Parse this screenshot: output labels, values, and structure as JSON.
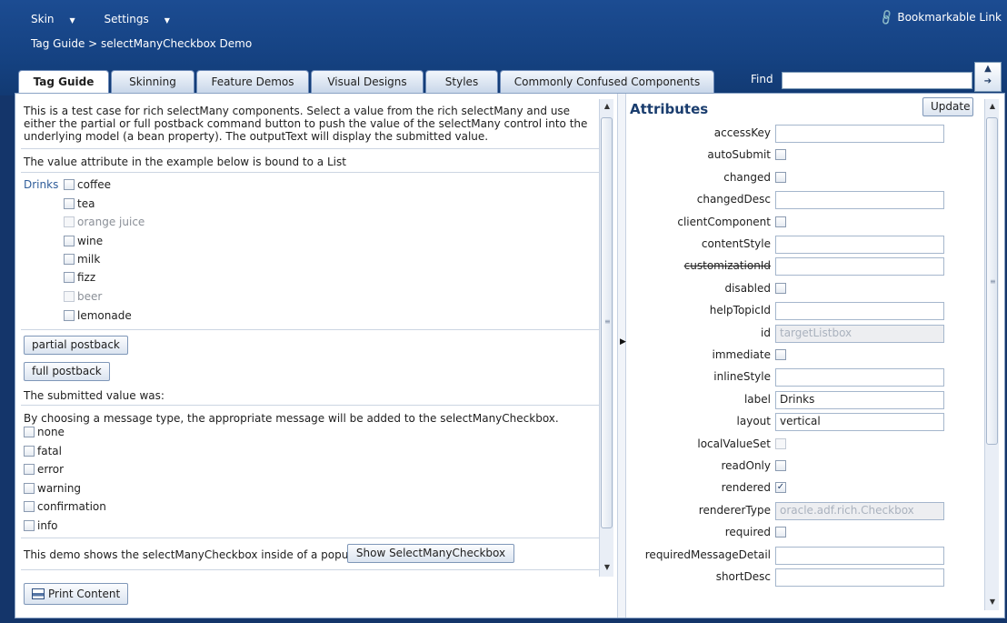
{
  "header": {
    "menus": [
      {
        "label": "Skin"
      },
      {
        "label": "Settings"
      }
    ],
    "breadcrumb": "Tag Guide > selectManyCheckbox Demo",
    "bookmark": "Bookmarkable Link",
    "find_label": "Find",
    "find_value": ""
  },
  "tabs": [
    {
      "label": "Tag Guide",
      "active": true
    },
    {
      "label": "Skinning"
    },
    {
      "label": "Feature Demos"
    },
    {
      "label": "Visual Designs"
    },
    {
      "label": "Styles"
    },
    {
      "label": "Commonly Confused Components"
    }
  ],
  "left": {
    "intro": "This is a test case for rich selectMany components. Select a value from the rich selectMany and use either the partial or full postback command button to push the value of the selectMany control into the underlying model (a bean property). The outputText will display the submitted value.",
    "value_note": "The value attribute in the example below is bound to a List",
    "drinks_label": "Drinks",
    "drinks": [
      {
        "label": "coffee",
        "disabled": false
      },
      {
        "label": "tea",
        "disabled": false
      },
      {
        "label": "orange juice",
        "disabled": true
      },
      {
        "label": "wine",
        "disabled": false
      },
      {
        "label": "milk",
        "disabled": false
      },
      {
        "label": "fizz",
        "disabled": false
      },
      {
        "label": "beer",
        "disabled": true
      },
      {
        "label": "lemonade",
        "disabled": false
      }
    ],
    "partial_button": "partial postback",
    "full_button": "full postback",
    "submitted_label": "The submitted value was:",
    "message_note": "By choosing a message type, the appropriate message will be added to the selectManyCheckbox.",
    "messages": [
      {
        "label": "none"
      },
      {
        "label": "fatal"
      },
      {
        "label": "error"
      },
      {
        "label": "warning"
      },
      {
        "label": "confirmation"
      },
      {
        "label": "info"
      }
    ],
    "popup_note": "This demo shows the selectManyCheckbox inside of a popup.",
    "popup_button": "Show SelectManyCheckbox",
    "print_button": "Print Content"
  },
  "attributes": {
    "title": "Attributes",
    "update_button": "Update",
    "rows": [
      {
        "name": "accessKey",
        "type": "text",
        "value": ""
      },
      {
        "name": "autoSubmit",
        "type": "checkbox",
        "checked": false
      },
      {
        "name": "changed",
        "type": "checkbox",
        "checked": false
      },
      {
        "name": "changedDesc",
        "type": "text",
        "value": ""
      },
      {
        "name": "clientComponent",
        "type": "checkbox",
        "checked": false
      },
      {
        "name": "contentStyle",
        "type": "text",
        "value": ""
      },
      {
        "name": "customizationId",
        "type": "text",
        "value": "",
        "deprecated": true
      },
      {
        "name": "disabled",
        "type": "checkbox",
        "checked": false
      },
      {
        "name": "helpTopicId",
        "type": "text",
        "value": ""
      },
      {
        "name": "id",
        "type": "readonly",
        "value": "targetListbox"
      },
      {
        "name": "immediate",
        "type": "checkbox",
        "checked": false
      },
      {
        "name": "inlineStyle",
        "type": "text",
        "value": ""
      },
      {
        "name": "label",
        "type": "text",
        "value": "Drinks"
      },
      {
        "name": "layout",
        "type": "text",
        "value": "vertical"
      },
      {
        "name": "localValueSet",
        "type": "checkbox",
        "checked": false,
        "disabled": true
      },
      {
        "name": "readOnly",
        "type": "checkbox",
        "checked": false
      },
      {
        "name": "rendered",
        "type": "checkbox",
        "checked": true
      },
      {
        "name": "rendererType",
        "type": "readonly",
        "value": "oracle.adf.rich.Checkbox"
      },
      {
        "name": "required",
        "type": "checkbox",
        "checked": false
      },
      {
        "name": "requiredMessageDetail",
        "type": "text",
        "value": ""
      },
      {
        "name": "shortDesc",
        "type": "text",
        "value": ""
      }
    ]
  }
}
